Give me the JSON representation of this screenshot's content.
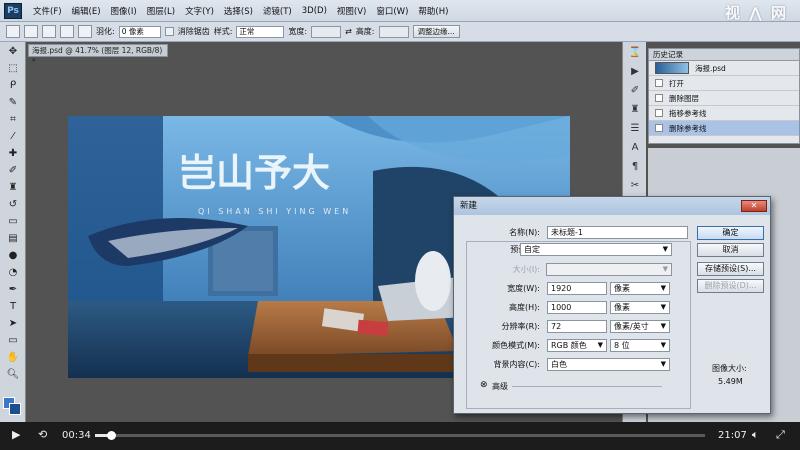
{
  "app": {
    "logo": "Ps",
    "watermark": "视 ⋀ 网"
  },
  "menubar": {
    "items": [
      "文件(F)",
      "编辑(E)",
      "图像(I)",
      "图层(L)",
      "文字(Y)",
      "选择(S)",
      "滤镜(T)",
      "3D(D)",
      "视图(V)",
      "窗口(W)",
      "帮助(H)"
    ]
  },
  "options": {
    "feather_label": "羽化:",
    "feather_value": "0 像素",
    "antialias_label": "消除锯齿",
    "style_label": "样式:",
    "style_value": "正常",
    "width_label": "宽度:",
    "height_label": "高度:",
    "refine_edge": "调整边缘..."
  },
  "document": {
    "tab": "海报.psd @ 41.7% (图层 12, RGB/8) *"
  },
  "history": {
    "title": "历史记录",
    "snapshot": "海报.psd",
    "steps": [
      "打开",
      "删除图层",
      "拖移参考线",
      "删除参考线"
    ],
    "selected_index": 3
  },
  "canvas": {
    "artwork_text": "岂山予大",
    "subtitle": "QI SHAN SHI YING WEN"
  },
  "dialog": {
    "title": "新建",
    "name_label": "名称(N):",
    "name_value": "未标题-1",
    "preset_label": "预设(P):",
    "preset_value": "自定",
    "size_label": "大小(I):",
    "width_label": "宽度(W):",
    "width_value": "1920",
    "width_unit": "像素",
    "height_label": "高度(H):",
    "height_value": "1000",
    "height_unit": "像素",
    "res_label": "分辨率(R):",
    "res_value": "72",
    "res_unit": "像素/英寸",
    "mode_label": "颜色模式(M):",
    "mode_value": "RGB 颜色",
    "depth_value": "8 位",
    "bg_label": "背景内容(C):",
    "bg_value": "白色",
    "advanced_label": "高级",
    "btn_ok": "确定",
    "btn_cancel": "取消",
    "btn_save_preset": "存储预设(S)...",
    "btn_delete_preset": "删除预设(D)...",
    "image_size_label": "图像大小:",
    "image_size_value": "5.49M",
    "close_icon": "✕"
  },
  "player": {
    "current_time": "00:34",
    "total_time": "21:07",
    "progress": 0.027
  }
}
